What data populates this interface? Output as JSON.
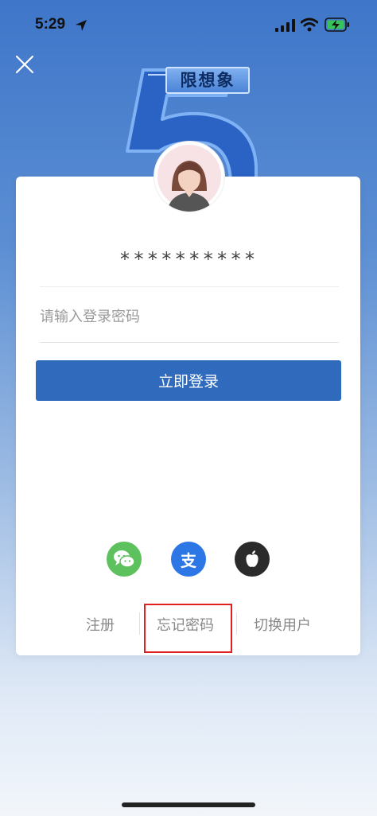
{
  "status_bar": {
    "time": "5:29"
  },
  "banner": {
    "tag": "限想象"
  },
  "login": {
    "account": "**********",
    "password_placeholder": "请输入登录密码",
    "login_button": "立即登录"
  },
  "social": {
    "alipay_glyph": "支"
  },
  "links": {
    "register": "注册",
    "forgot_password": "忘记密码",
    "switch_user": "切换用户"
  },
  "colors": {
    "primary": "#2f6abc",
    "wechat": "#5dc15d",
    "alipay": "#2c76e6",
    "apple": "#2b2b2b",
    "highlight": "#e02020"
  }
}
